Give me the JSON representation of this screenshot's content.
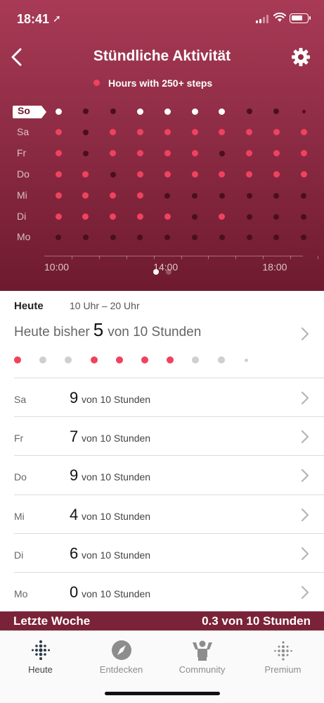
{
  "status_bar": {
    "time": "18:41",
    "location_glyph": "➚"
  },
  "header": {
    "title": "Stündliche Aktivität",
    "legend": "Hours with 250+ steps",
    "accent": "#f0425e"
  },
  "chart_data": {
    "type": "scatter",
    "days": [
      "So",
      "Sa",
      "Fr",
      "Do",
      "Mi",
      "Di",
      "Mo"
    ],
    "hours": [
      10,
      11,
      12,
      13,
      14,
      15,
      16,
      17,
      18,
      19
    ],
    "x_tick_labels": [
      "10:00",
      "14:00",
      "18:00"
    ],
    "current_day": "So",
    "grid": [
      [
        1,
        0,
        0,
        1,
        1,
        1,
        1,
        0,
        0,
        -1
      ],
      [
        1,
        0,
        1,
        1,
        1,
        1,
        1,
        1,
        1,
        1
      ],
      [
        1,
        0,
        1,
        1,
        1,
        1,
        0,
        1,
        1,
        1
      ],
      [
        1,
        1,
        0,
        1,
        1,
        1,
        1,
        1,
        1,
        1
      ],
      [
        1,
        1,
        1,
        1,
        0,
        0,
        0,
        0,
        0,
        0
      ],
      [
        1,
        1,
        1,
        1,
        1,
        0,
        1,
        0,
        0,
        0
      ],
      [
        0,
        0,
        0,
        0,
        0,
        0,
        0,
        0,
        0,
        0
      ]
    ],
    "colors": {
      "active": "#f0425e",
      "today_active": "#ffffff",
      "inactive": "#4a0f1e"
    },
    "pager": {
      "pages": 2,
      "current": 1
    }
  },
  "today": {
    "label": "Heute",
    "range": "10 Uhr – 20 Uhr",
    "summary_prefix": "Heute bisher",
    "summary_count": "5",
    "summary_suffix": "von 10 Stunden",
    "hours": [
      1,
      0,
      0,
      1,
      1,
      1,
      1,
      0,
      0,
      -1
    ]
  },
  "days": [
    {
      "day": "Sa",
      "count": "9",
      "suffix": "von 10 Stunden"
    },
    {
      "day": "Fr",
      "count": "7",
      "suffix": "von 10 Stunden"
    },
    {
      "day": "Do",
      "count": "9",
      "suffix": "von 10 Stunden"
    },
    {
      "day": "Mi",
      "count": "4",
      "suffix": "von 10 Stunden"
    },
    {
      "day": "Di",
      "count": "6",
      "suffix": "von 10 Stunden"
    },
    {
      "day": "Mo",
      "count": "0",
      "suffix": "von 10 Stunden"
    }
  ],
  "last_week": {
    "label": "Letzte Woche",
    "value": "0.3 von 10 Stunden"
  },
  "tabbar": {
    "tabs": [
      {
        "label": "Heute",
        "icon": "fitbit-dots-icon",
        "active": true
      },
      {
        "label": "Entdecken",
        "icon": "compass-icon",
        "active": false
      },
      {
        "label": "Community",
        "icon": "community-icon",
        "active": false
      },
      {
        "label": "Premium",
        "icon": "premium-dots-icon",
        "active": false
      }
    ]
  }
}
